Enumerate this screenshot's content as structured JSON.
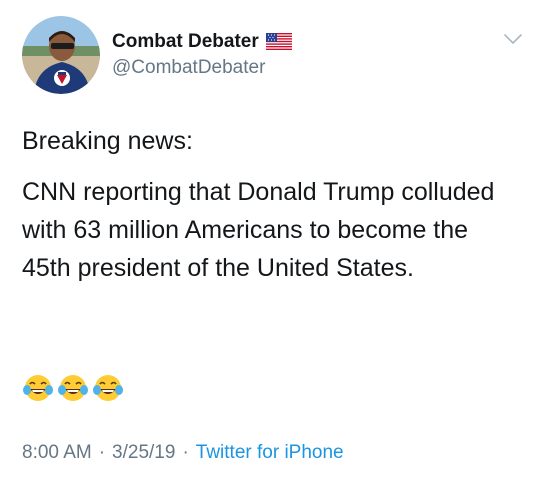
{
  "tweet": {
    "author": {
      "display_name": "Combat Debater",
      "handle": "@CombatDebater",
      "flag_icon": "us-flag-icon",
      "avatar_icon": "profile-photo"
    },
    "menu_icon": "chevron-down-icon",
    "paragraphs": [
      "Breaking news:",
      "CNN reporting that Donald Trump colluded with 63 million Americans to become the 45th president of the United States."
    ],
    "emojis": [
      "face-with-tears-of-joy",
      "face-with-tears-of-joy",
      "face-with-tears-of-joy"
    ],
    "time": "8:00 AM",
    "date": "3/25/19",
    "separator": "·",
    "source": "Twitter for iPhone"
  },
  "colors": {
    "text": "#14171a",
    "muted": "#657786",
    "link": "#1b95e0"
  }
}
